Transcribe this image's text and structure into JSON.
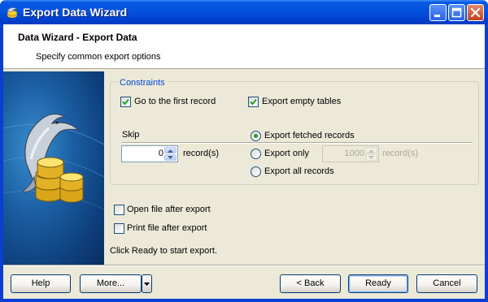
{
  "window": {
    "title": "Export Data Wizard"
  },
  "header": {
    "title": "Data Wizard - Export Data",
    "subtitle": "Specify common export options"
  },
  "constraints": {
    "legend": "Constraints",
    "go_first_record": {
      "label": "Go to the first record",
      "checked": true
    },
    "export_empty_tables": {
      "label": "Export empty tables",
      "checked": true
    },
    "skip": {
      "label": "Skip",
      "value": "0",
      "unit": "record(s)"
    },
    "export_mode": {
      "options": [
        "Export fetched records",
        "Export only",
        "Export all records"
      ],
      "selected": "Export fetched records"
    },
    "export_only": {
      "value": "1000",
      "unit": "record(s)"
    }
  },
  "options": {
    "open_after_export": {
      "label": "Open file after export",
      "checked": false
    },
    "print_after_export": {
      "label": "Print file after export",
      "checked": false
    }
  },
  "hint": "Click Ready to start export.",
  "buttons": {
    "help": "Help",
    "more": "More...",
    "back": "< Back",
    "ready": "Ready",
    "cancel": "Cancel"
  },
  "colors": {
    "accent": "#0046d5",
    "radio_dot": "#21a121",
    "titlebar": "#0453de"
  },
  "icons": [
    "app-icon",
    "minimize-icon",
    "maximize-icon",
    "close-icon",
    "dolphin-database-icon",
    "checkmark-icon",
    "spin-up-arrow-icon",
    "spin-down-arrow-icon",
    "dropdown-arrow-icon"
  ]
}
